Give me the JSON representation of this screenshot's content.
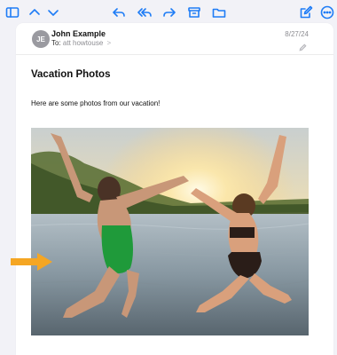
{
  "toolbar": {
    "icons": [
      "sidebar-icon",
      "chevron-up-icon",
      "chevron-down-icon",
      "reply-icon",
      "reply-all-icon",
      "forward-icon",
      "archive-icon",
      "folder-icon",
      "compose-icon",
      "more-icon"
    ],
    "accent_color": "#1e7cf6"
  },
  "message": {
    "avatar_initials": "JE",
    "sender_name": "John Example",
    "to_label": "To:",
    "to_value": "att howtouse",
    "to_chevron": ">",
    "date": "8/27/24",
    "subject": "Vacation Photos",
    "body": "Here are some photos from our vacation!"
  },
  "annotation": {
    "arrow_color": "#f5a623"
  }
}
